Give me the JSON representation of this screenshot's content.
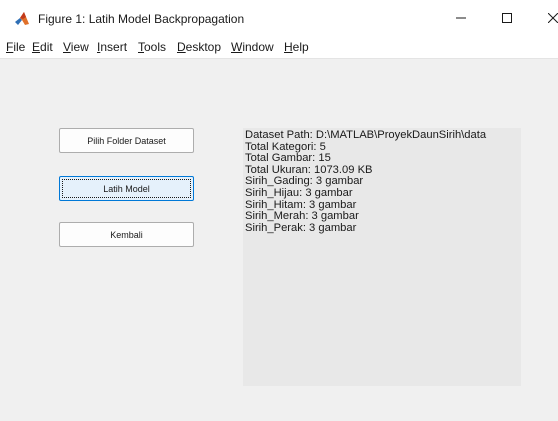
{
  "window": {
    "title": "Figure 1: Latih Model Backpropagation",
    "icon": "matlab-icon",
    "controls": {
      "minimize": "minimize-icon",
      "maximize": "maximize-icon",
      "close": "close-icon"
    }
  },
  "menubar": {
    "items": [
      "File",
      "Edit",
      "View",
      "Insert",
      "Tools",
      "Desktop",
      "Window",
      "Help"
    ]
  },
  "buttons": {
    "select_folder": "Pilih Folder Dataset",
    "train_model": "Latih Model",
    "back": "Kembali"
  },
  "info": {
    "lines": [
      "Dataset Path: D:\\MATLAB\\ProyekDaunSirih\\data",
      "Total Kategori: 5",
      "Total Gambar: 15",
      "Total Ukuran: 1073.09 KB",
      "Sirih_Gading: 3 gambar",
      "Sirih_Hijau: 3 gambar",
      "Sirih_Hitam: 3 gambar",
      "Sirih_Merah: 3 gambar",
      "Sirih_Perak: 3 gambar"
    ]
  },
  "colors": {
    "figure_background": "#f0f0f0",
    "info_background": "#e8e8e8",
    "focus_border": "#0078d7"
  }
}
